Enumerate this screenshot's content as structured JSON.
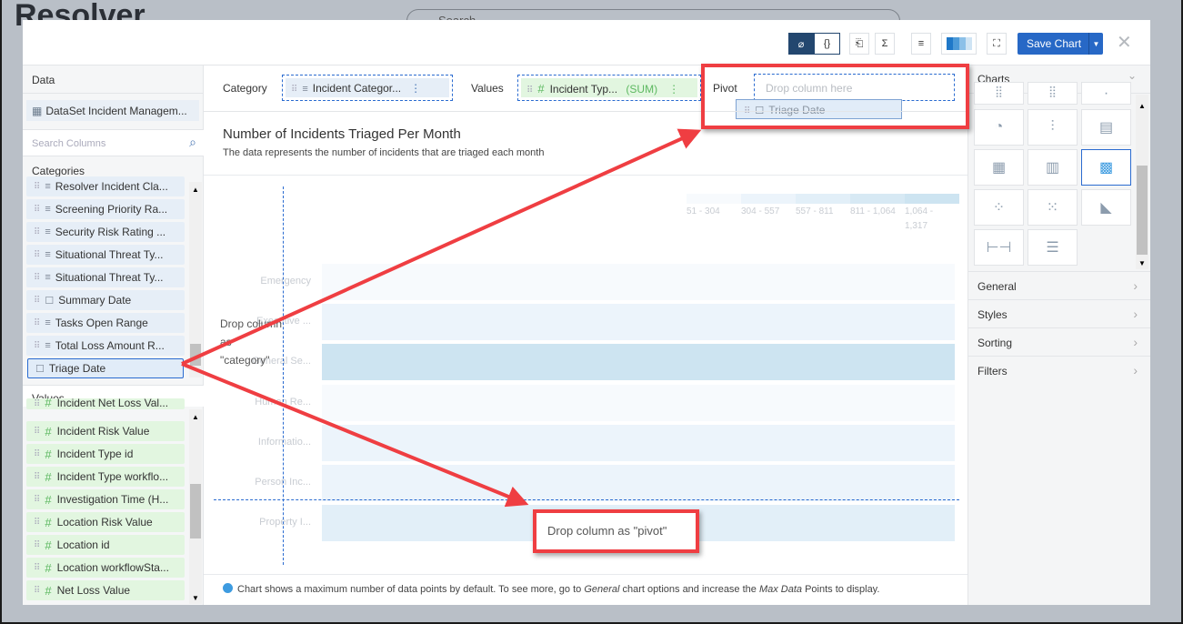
{
  "background": {
    "logo": "Resolver",
    "search_placeholder": "Search"
  },
  "toolbar": {
    "tag_label": "⌀",
    "code_label": "{}",
    "import_label": "⎗",
    "sum_label": "Σ",
    "filter_label": "≡",
    "fullscreen_label": "⛶",
    "save_label": "Save Chart",
    "close_label": "✕"
  },
  "left": {
    "data_header": "Data",
    "dataset": "DataSet Incident Managem...",
    "search_placeholder": "Search Columns",
    "categories_header": "Categories",
    "categories": [
      {
        "label": "Resolver Incident Cla...",
        "type": "text"
      },
      {
        "label": "Screening Priority Ra...",
        "type": "text"
      },
      {
        "label": "Security Risk Rating ...",
        "type": "text"
      },
      {
        "label": "Situational Threat Ty...",
        "type": "text"
      },
      {
        "label": "Situational Threat Ty...",
        "type": "text"
      },
      {
        "label": "Summary Date",
        "type": "date"
      },
      {
        "label": "Tasks Open Range",
        "type": "text"
      },
      {
        "label": "Total Loss Amount R...",
        "type": "text"
      }
    ],
    "dragged_item": "Triage Date",
    "values_header": "Values",
    "values": [
      "Incident Net Loss Val...",
      "Incident Risk Value",
      "Incident Type id",
      "Incident Type workflo...",
      "Investigation Time (H...",
      "Location Risk Value",
      "Location id",
      "Location workflowSta...",
      "Net Loss Value"
    ]
  },
  "dropbar": {
    "category_label": "Category",
    "category_chip": "Incident Categor...",
    "values_label": "Values",
    "values_chip": "Incident Typ...",
    "values_agg": "(SUM)",
    "pivot_label": "Pivot",
    "pivot_placeholder": "Drop column here",
    "drag_ghost": "Triage Date"
  },
  "chart": {
    "title": "Number of Incidents Triaged Per Month",
    "subtitle": "The data represents the number of incidents that are triaged each month",
    "drop_category_hint": "Drop column as \"category\"",
    "drop_pivot_hint": "Drop column as \"pivot\"",
    "footer_pre": "Chart shows a maximum number of data points by default. To see more, go to ",
    "footer_em1": "General",
    "footer_mid": " chart options and increase the ",
    "footer_em2": "Max Data",
    "footer_post": " Points to display."
  },
  "chart_data": {
    "type": "heatmap",
    "legend": [
      {
        "label": "51 - 304",
        "color": "#f7fafd"
      },
      {
        "label": "304 - 557",
        "color": "#ecf4fb"
      },
      {
        "label": "557 - 811",
        "color": "#e2eff8"
      },
      {
        "label": "811 - 1,064",
        "color": "#d7e9f4"
      },
      {
        "label": "1,064 - 1,317",
        "color": "#cde4f1"
      }
    ],
    "categories": [
      "Emergency",
      "Executive ...",
      "General Se...",
      "Human Re...",
      "Informatio...",
      "Person Inc...",
      "Property I..."
    ],
    "bins": [
      0,
      1,
      4,
      0,
      1,
      1,
      2
    ]
  },
  "right": {
    "charts_header": "Charts",
    "sections": [
      "General",
      "Styles",
      "Sorting",
      "Filters"
    ]
  }
}
